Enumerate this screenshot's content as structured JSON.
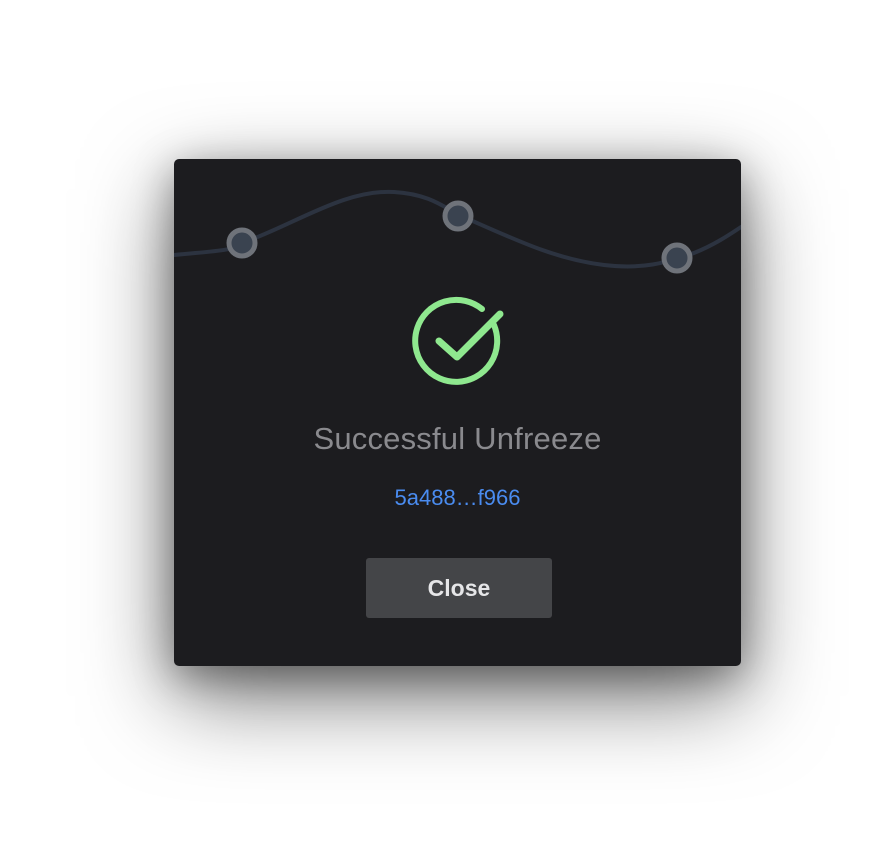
{
  "dialog": {
    "title": "Successful Unfreeze",
    "transaction_link": "5a488…f966",
    "close_label": "Close"
  },
  "icons": {
    "status": "check-circle-icon",
    "decoration": "wave-nodes-graphic"
  },
  "colors": {
    "modal_background": "#1c1c1f",
    "success_green": "#8fe88f",
    "link_blue": "#4a8cf0",
    "title_gray": "#8a8a8e",
    "button_background": "#444548",
    "wave_line": "#2c3340",
    "node_ring": "#6f737a",
    "node_fill": "#3a4350"
  }
}
